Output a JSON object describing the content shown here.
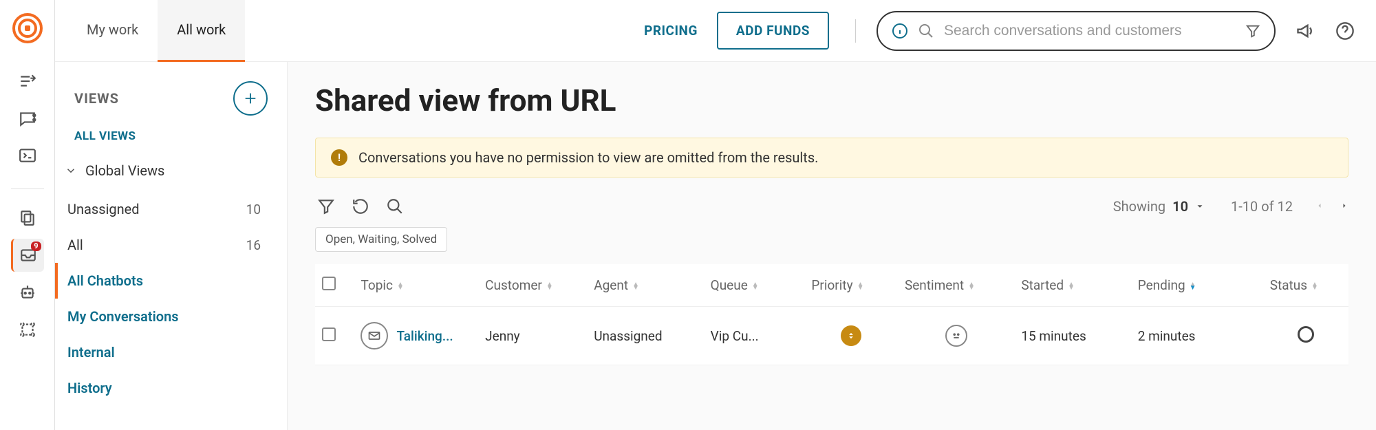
{
  "rail": {
    "badge": "9"
  },
  "tabs": {
    "my_work": "My work",
    "all_work": "All work"
  },
  "header": {
    "pricing": "PRICING",
    "add_funds": "ADD FUNDS",
    "search_placeholder": "Search conversations and customers"
  },
  "sidebar": {
    "views_title": "VIEWS",
    "all_views": "ALL VIEWS",
    "global_views": "Global Views",
    "items": [
      {
        "label": "Unassigned",
        "count": "10"
      },
      {
        "label": "All",
        "count": "16"
      },
      {
        "label": "All Chatbots",
        "count": ""
      },
      {
        "label": "My Conversations",
        "count": ""
      },
      {
        "label": "Internal",
        "count": ""
      },
      {
        "label": "History",
        "count": ""
      }
    ]
  },
  "content": {
    "title": "Shared view from URL",
    "notice": "Conversations you have no permission to view are omitted from the results.",
    "showing_label": "Showing",
    "showing_value": "10",
    "pager_range": "1-10 of 12",
    "chip": "Open, Waiting, Solved",
    "columns": {
      "topic": "Topic",
      "customer": "Customer",
      "agent": "Agent",
      "queue": "Queue",
      "priority": "Priority",
      "sentiment": "Sentiment",
      "started": "Started",
      "pending": "Pending",
      "status": "Status"
    },
    "rows": [
      {
        "topic": "Taliking...",
        "customer": "Jenny",
        "agent": "Unassigned",
        "queue": "Vip Cu...",
        "started": "15 minutes",
        "pending": "2 minutes"
      }
    ]
  }
}
